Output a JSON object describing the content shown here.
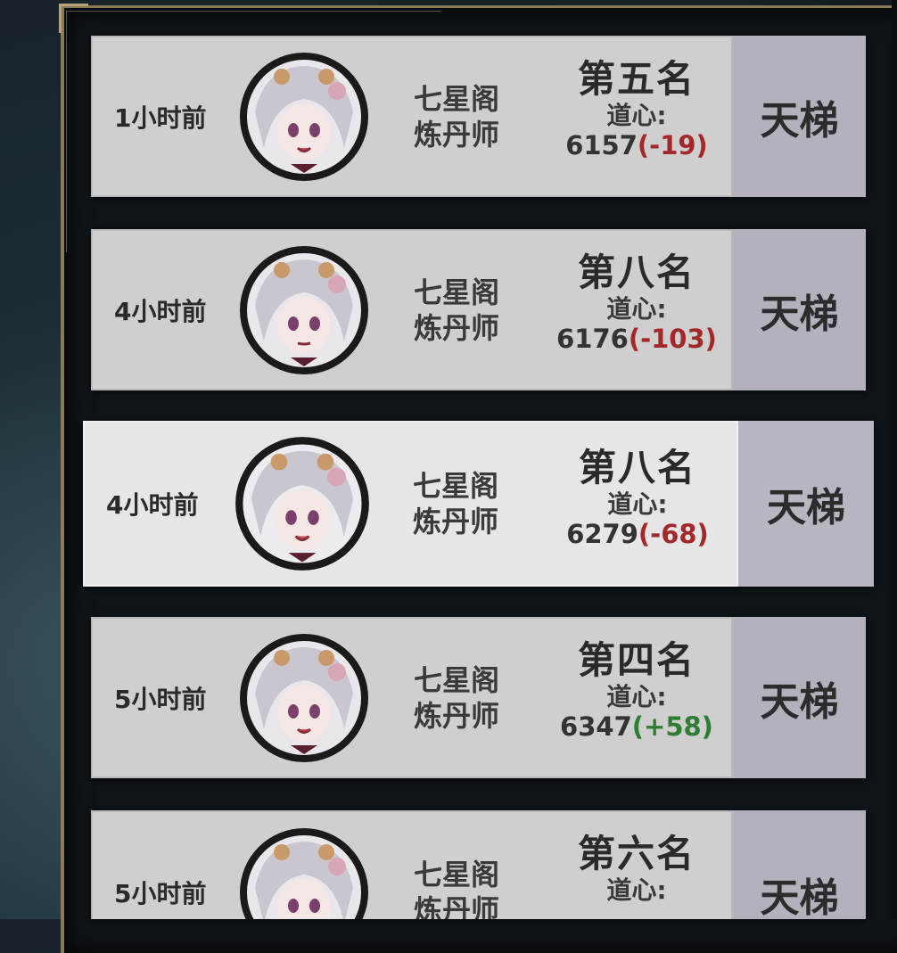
{
  "colors": {
    "negative": "#a3282a",
    "positive": "#2e7d32",
    "card": "#cfcfcf",
    "card_side": "#b4b1bc"
  },
  "entries": [
    {
      "time": "1小时前",
      "guild": "七星阁",
      "role": "炼丹师",
      "rank": "第五名",
      "dao_label": "道心:",
      "score": "6157",
      "delta": "(-19)",
      "delta_sign": "neg",
      "mode": "天梯",
      "avatar_icon": "character-portrait-icon"
    },
    {
      "time": "4小时前",
      "guild": "七星阁",
      "role": "炼丹师",
      "rank": "第八名",
      "dao_label": "道心:",
      "score": "6176",
      "delta": "(-103)",
      "delta_sign": "neg",
      "mode": "天梯",
      "avatar_icon": "character-portrait-icon"
    },
    {
      "time": "4小时前",
      "guild": "七星阁",
      "role": "炼丹师",
      "rank": "第八名",
      "dao_label": "道心:",
      "score": "6279",
      "delta": "(-68)",
      "delta_sign": "neg",
      "mode": "天梯",
      "avatar_icon": "character-portrait-icon",
      "selected": true
    },
    {
      "time": "5小时前",
      "guild": "七星阁",
      "role": "炼丹师",
      "rank": "第四名",
      "dao_label": "道心:",
      "score": "6347",
      "delta": "(+58)",
      "delta_sign": "pos",
      "mode": "天梯",
      "avatar_icon": "character-portrait-icon"
    },
    {
      "time": "5小时前",
      "guild": "七星阁",
      "role": "炼丹师",
      "rank": "第六名",
      "dao_label": "道心:",
      "mode": "天梯",
      "avatar_icon": "character-portrait-icon"
    }
  ]
}
